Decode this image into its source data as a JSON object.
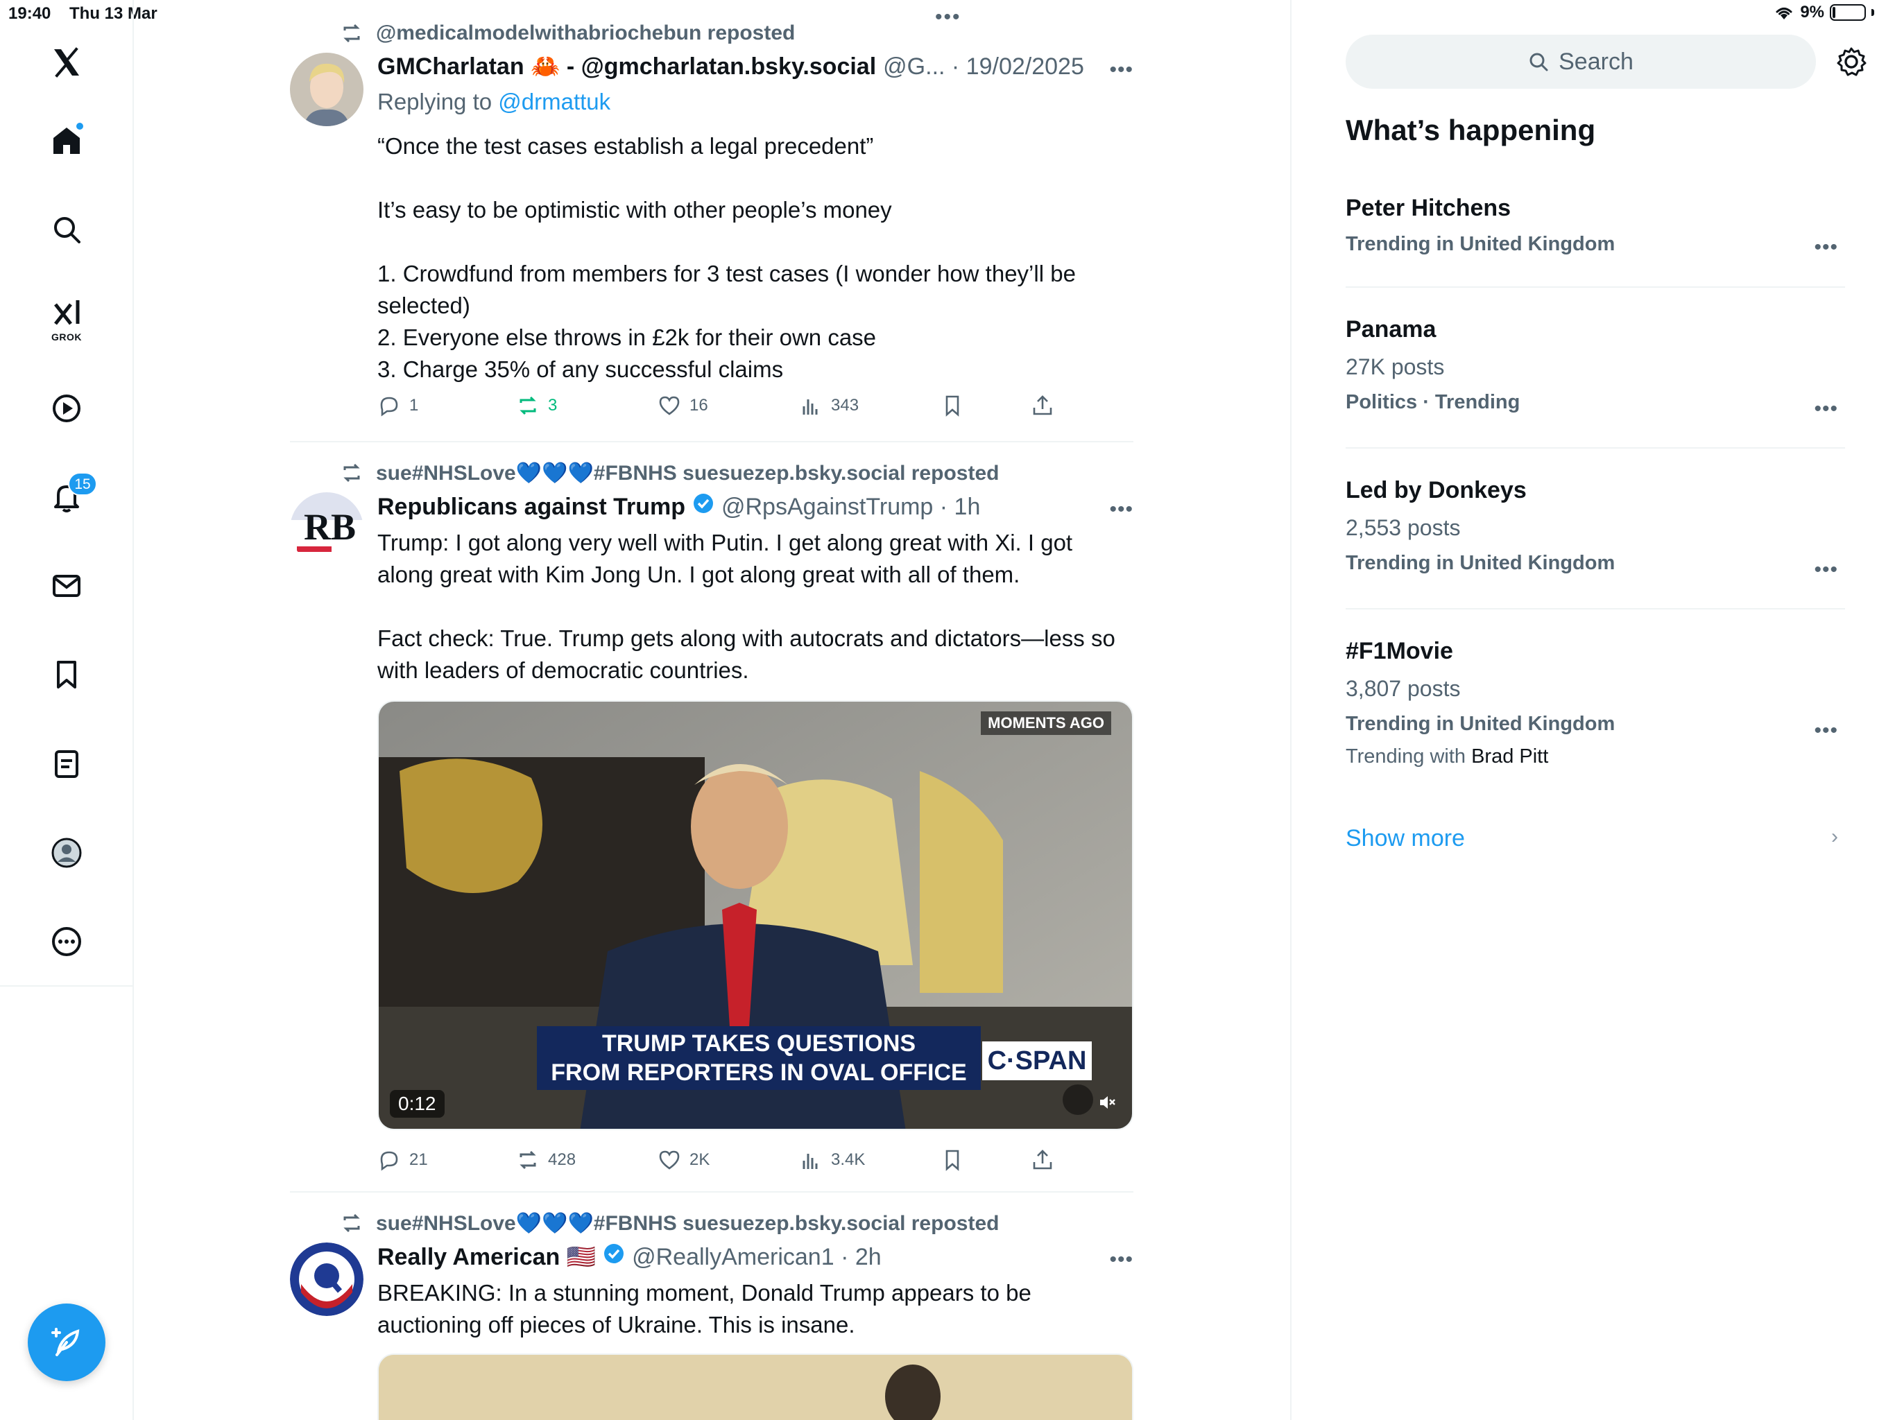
{
  "status_bar": {
    "time": "19:40",
    "date": "Thu 13 Mar",
    "battery": "9%",
    "battery_level": 0.09
  },
  "nav": {
    "grok_label": "GROK",
    "notifications_count": "15"
  },
  "feed": {
    "posts": [
      {
        "reposted_by": "@medicalmodelwithabriochebun reposted",
        "name": "GMCharlatan 🦀 - @gmcharlatan.bsky.social",
        "meta": "@G... · 19/02/2025",
        "replying_prefix": "Replying to",
        "replying_handle": "@drmattuk",
        "text": [
          "“Once the test cases establish a legal precedent”",
          "",
          "It’s easy to be optimistic with other people’s money",
          "",
          "1. Crowdfund from members for 3 test cases (I wonder how they’ll be selected)",
          "2. Everyone else throws in £2k for their own case",
          "3. Charge 35% of any successful claims"
        ],
        "stats": {
          "replies": "1",
          "reposts": "3",
          "likes": "16",
          "views": "343"
        }
      },
      {
        "reposted_by": "sue#NHSLove💙💙💙#FBNHS suesuezep.bsky.social reposted",
        "name": "Republicans against Trump",
        "meta": "@RpsAgainstTrump · 1h",
        "avatar_text": "RB",
        "text": [
          "Trump: I got along very well with Putin. I get along great with Xi. I got along great with Kim Jong Un. I got along great with all of them.",
          "",
          "Fact check: True. Trump gets along with autocrats and dictators—less so with leaders of democratic countries."
        ],
        "video": {
          "badge": "MOMENTS AGO",
          "caption_line1": "TRUMP TAKES QUESTIONS",
          "caption_line2": "FROM REPORTERS IN OVAL OFFICE",
          "network": "C·SPAN",
          "duration": "0:12"
        },
        "stats": {
          "replies": "21",
          "reposts": "428",
          "likes": "2K",
          "views": "3.4K"
        }
      },
      {
        "reposted_by": "sue#NHSLove💙💙💙#FBNHS suesuezep.bsky.social reposted",
        "name": "Really American 🇺🇸",
        "meta": "@ReallyAmerican1 · 2h",
        "text": [
          "BREAKING: In a stunning moment, Donald Trump appears to be auctioning off pieces of Ukraine. This is insane."
        ]
      }
    ]
  },
  "sidebar": {
    "search_placeholder": "Search",
    "title": "What’s happening",
    "trends": [
      {
        "name": "Peter Hitchens",
        "meta": "Trending in United Kingdom"
      },
      {
        "name": "Panama",
        "posts": "27K posts",
        "meta": "Politics · Trending"
      },
      {
        "name": "Led by Donkeys",
        "posts": "2,553 posts",
        "meta": "Trending in United Kingdom"
      },
      {
        "name": "#F1Movie",
        "posts": "3,807 posts",
        "meta": "Trending in United Kingdom",
        "with_prefix": "Trending with",
        "with_name": "Brad Pitt"
      }
    ],
    "show_more": "Show more"
  },
  "colors": {
    "accent": "#1d9bf0",
    "secondary_text": "#536471",
    "repost_green": "#00ba7c",
    "divider": "#eff3f4"
  }
}
